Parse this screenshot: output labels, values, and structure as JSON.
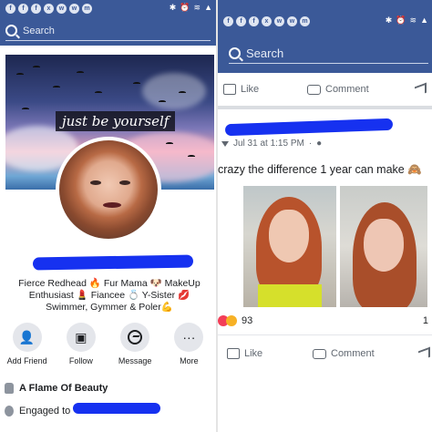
{
  "status_bar": {
    "left_icons": [
      "f",
      "f",
      "f",
      "x",
      "w",
      "w",
      "m"
    ],
    "right_icons": [
      "bluetooth",
      "alarm",
      "wifi",
      "signal",
      "battery"
    ]
  },
  "left": {
    "search": {
      "placeholder": "Search"
    },
    "cover": {
      "caption": "just be yourself"
    },
    "bio": "Fierce Redhead 🔥 Fur Mama 🐶 MakeUp Enthusiast 💄 Fiancee 💍 Y-Sister 💋 Swimmer, Gymmer & Poler💪",
    "actions": [
      {
        "label": "Add Friend",
        "icon": "add-friend-icon"
      },
      {
        "label": "Follow",
        "icon": "follow-icon"
      },
      {
        "label": "Message",
        "icon": "messenger-icon"
      },
      {
        "label": "More",
        "icon": "more-icon"
      }
    ],
    "info": [
      {
        "bold": "A Flame Of Beauty"
      },
      {
        "text": "Engaged to"
      }
    ]
  },
  "right": {
    "search": {
      "placeholder": "Search"
    },
    "top_actions": {
      "like": "Like",
      "comment": "Comment"
    },
    "post": {
      "date": "Jul 31 at 1:15 PM",
      "separator": "·",
      "text": "crazy the difference 1 year can make 🙈",
      "reactions_count": "93",
      "comments_count": "1"
    },
    "bottom_actions": {
      "like": "Like",
      "comment": "Comment"
    }
  },
  "colors": {
    "brand": "#3b5998",
    "redaction": "#1631f0",
    "divider": "#dadde1"
  }
}
